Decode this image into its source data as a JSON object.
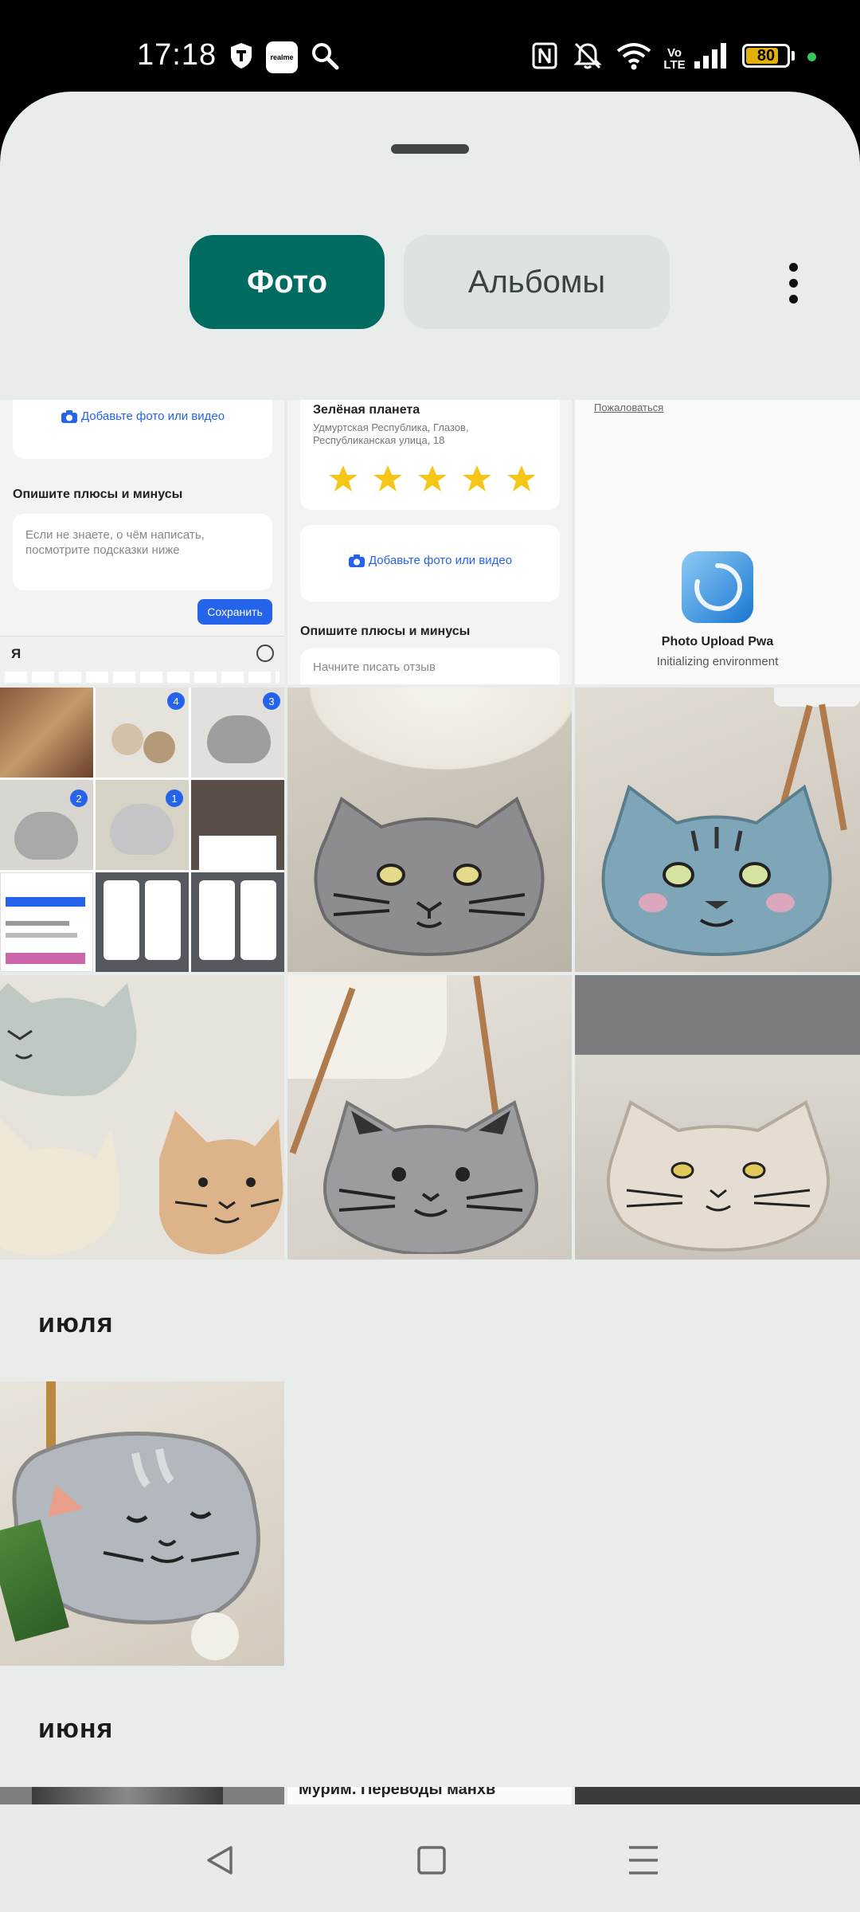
{
  "status_bar": {
    "time": "17:18",
    "realme_label": "realme",
    "volte_top": "Vo",
    "volte_bottom": "LTE",
    "battery_level": "80",
    "battery_fraction": 0.8,
    "icons": [
      "shield-icon",
      "realme-app-icon",
      "search-icon",
      "nfc-icon",
      "mute-icon",
      "wifi-icon",
      "volte-icon",
      "signal-icon",
      "battery-icon"
    ]
  },
  "tabs": {
    "photos_label": "Фото",
    "albums_label": "Альбомы"
  },
  "screenshot_tiles": {
    "tile1": {
      "add_media": "Добавьте фото или видео",
      "pros_cons_heading": "Опишите плюсы и минусы",
      "hint_placeholder": "Если не знаете, о чём написать, посмотрите подсказки ниже",
      "save_button": "Сохранить",
      "keyboard_logo": "Я"
    },
    "tile2": {
      "place_name": "Зелёная планета",
      "address": "Удмуртская Республика, Глазов, Республиканская улица, 18",
      "rating_stars": 5,
      "add_media": "Добавьте фото или видео",
      "pros_cons_heading": "Опишите плюсы и минусы",
      "review_placeholder": "Начните писать отзыв"
    },
    "tile3": {
      "complain_link": "Пожаловаться",
      "app_name": "Photo Upload Pwa",
      "app_status": "Initializing environment"
    },
    "collage_badges": [
      "4",
      "3",
      "2",
      "1"
    ]
  },
  "sections": {
    "july": "июля",
    "june": "июня",
    "june_peek_text": "Мурим. Переводы манхв"
  },
  "colors": {
    "accent": "#006b60",
    "sheet_bg": "#e8edeb",
    "tab_inactive_bg": "#dde3e1"
  },
  "nav_bar": {
    "icons": [
      "back-icon",
      "home-icon",
      "recents-icon"
    ]
  }
}
